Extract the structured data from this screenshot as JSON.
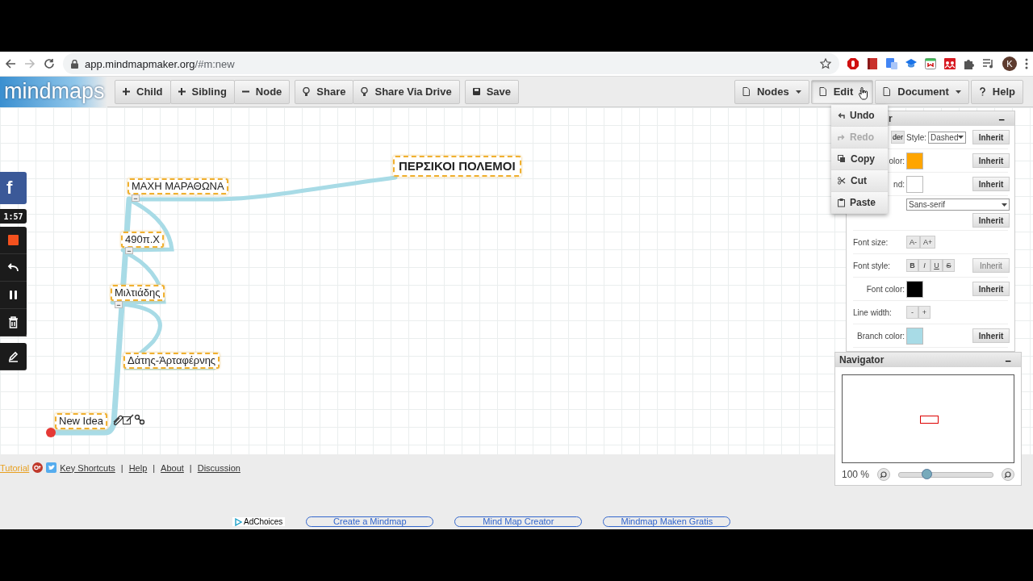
{
  "browser": {
    "url_host": "app.mindmapmaker.org",
    "url_path": "/#m:new",
    "forward_disabled": true,
    "avatar": "K"
  },
  "toolbar": {
    "logo": "mindmaps",
    "groups": [
      [
        {
          "label": "Child"
        },
        {
          "label": "Sibling"
        },
        {
          "label": "Node"
        }
      ],
      [
        {
          "label": "Share"
        },
        {
          "label": "Share Via Drive"
        }
      ],
      [
        {
          "label": "Save"
        }
      ]
    ],
    "menus": [
      {
        "label": "Nodes",
        "selected": false
      },
      {
        "label": "Edit",
        "selected": true
      },
      {
        "label": "Document",
        "selected": false
      },
      {
        "label": "Help",
        "selected": false
      }
    ]
  },
  "edit_menu": [
    {
      "label": "Undo",
      "disabled": false
    },
    {
      "label": "Redo",
      "disabled": true
    },
    {
      "label": "Copy",
      "disabled": false
    },
    {
      "label": "Cut",
      "disabled": false
    },
    {
      "label": "Paste",
      "disabled": false
    }
  ],
  "inspector": {
    "title": "r",
    "minimize": "–",
    "rows": [
      {
        "kind": "style",
        "button": "der",
        "label": "Style:",
        "value": "Dashed",
        "inherit": "Inherit"
      },
      {
        "kind": "color",
        "label": "olor:",
        "color": "#ffa500",
        "inherit": "Inherit"
      },
      {
        "kind": "color",
        "label": "nd:",
        "color": "#ffffff",
        "inherit": "Inherit"
      },
      {
        "kind": "select",
        "value": "Sans-serif",
        "inherit": "Inherit"
      },
      {
        "kind": "pair",
        "label": "Font size:",
        "buttons": [
          "A-",
          "A+"
        ]
      },
      {
        "kind": "fontstyle",
        "label": "Font style:",
        "buttons": [
          "B",
          "I",
          "U",
          "S"
        ],
        "inherit": "Inherit",
        "inherit_disabled": true
      },
      {
        "kind": "color",
        "label": "Font color:",
        "color": "#000000",
        "inherit": "Inherit"
      },
      {
        "kind": "pair",
        "label": "Line width:",
        "buttons": [
          "-",
          "+"
        ]
      },
      {
        "kind": "color",
        "label": "Branch color:",
        "color": "#a8dbe6",
        "inherit": "Inherit"
      }
    ]
  },
  "navigator": {
    "title": "Navigator",
    "minimize": "–",
    "zoom": "100 %",
    "level": 0.3
  },
  "recorder": {
    "facebook": "f",
    "timer": "1:57",
    "buttons": [
      {
        "kind": "stop"
      },
      {
        "kind": "undo"
      },
      {
        "kind": "pause"
      },
      {
        "kind": "trash"
      },
      {
        "kind": "pen"
      }
    ]
  },
  "mindmap": {
    "nodes": [
      {
        "kind": "root",
        "text": "ΠΕΡΣΙΚΟΙ ΠΟΛΕΜΟΙ",
        "selected": false
      },
      {
        "kind": "child",
        "text": "ΜΑΧΗ ΜΑΡΑΘΩΝΑ",
        "collapse": "−",
        "selected": false
      },
      {
        "kind": "child",
        "text": "490π.Χ",
        "collapse": "−",
        "selected": false
      },
      {
        "kind": "child",
        "text": "Μιλτιάδης",
        "collapse": "−",
        "selected": false
      },
      {
        "kind": "child",
        "text": "Δάτης-Άρταφέρνης",
        "selected": false
      },
      {
        "kind": "child",
        "text": "New Idea",
        "selected": true
      }
    ]
  },
  "footer": {
    "items": [
      {
        "kind": "tutorial",
        "text": "Tutorial"
      },
      {
        "kind": "gplus"
      },
      {
        "kind": "twitter"
      },
      {
        "kind": "link",
        "text": "Key Shortcuts"
      },
      {
        "kind": "separator",
        "text": "|"
      },
      {
        "kind": "link",
        "text": "Help"
      },
      {
        "kind": "separator",
        "text": "|"
      },
      {
        "kind": "link",
        "text": "About"
      },
      {
        "kind": "separator",
        "text": "|"
      },
      {
        "kind": "link",
        "text": "Discussion"
      }
    ],
    "adchoices": "AdChoices",
    "ads": [
      "Create a Mindmap",
      "Mind Map Creator",
      "Mindmap Maken Gratis"
    ]
  }
}
